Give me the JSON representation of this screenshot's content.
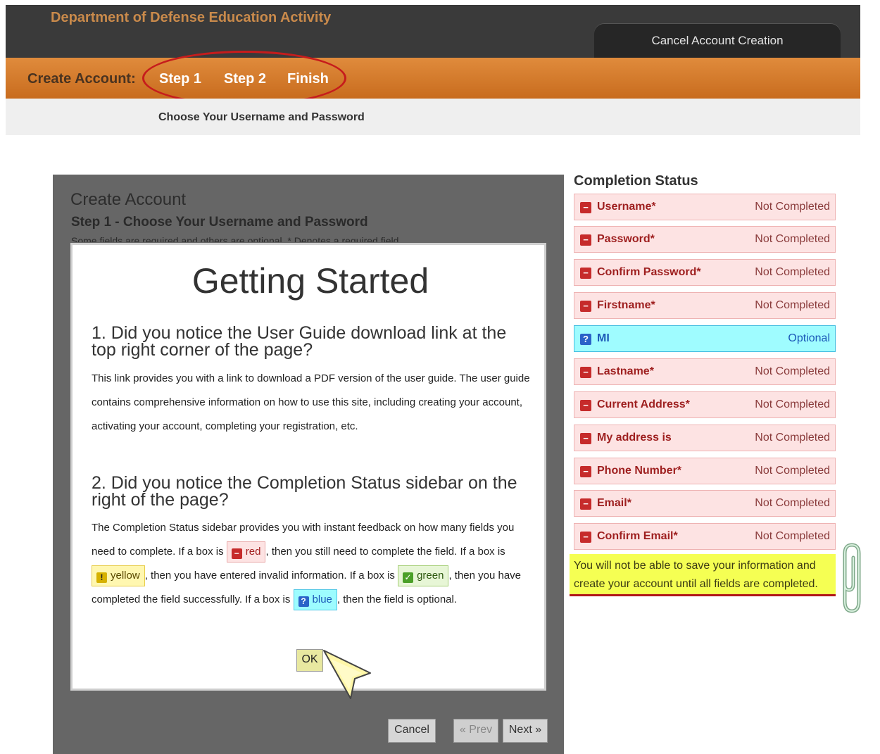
{
  "header": {
    "org_title": "Department of Defense Education Activity",
    "cancel_label": "Cancel Account Creation"
  },
  "steps": {
    "label": "Create Account:",
    "items": [
      "Step 1",
      "Step 2",
      "Finish"
    ],
    "active_index": 0,
    "subtitle": "Choose Your Username and Password"
  },
  "panel": {
    "title": "Create Account",
    "subtitle": "Step 1 - Choose Your Username and Password",
    "note": "Some fields are required and others are optional. * Denotes a required field."
  },
  "modal": {
    "title": "Getting Started",
    "q1": "1. Did you notice the User Guide download link at the top right corner of the page?",
    "p1": "This link provides you with a link to download a PDF version of the user guide. The user guide contains comprehensive information on how to use this site, including creating your account, activating your account, completing your registration, etc.",
    "q2": "2. Did you notice the Completion Status sidebar on the right of the page?",
    "p2_a": "The Completion Status sidebar provides you with instant feedback on how many fields you need to complete. If a box is",
    "chip_red": "red",
    "p2_b": ", then you still need to complete the field. If a box is",
    "chip_yellow": "yellow",
    "p2_c": ", then you have entered invalid information. If a box is",
    "chip_green": "green",
    "p2_d": ", then you have completed the field successfully. If a box is",
    "chip_blue": "blue",
    "p2_e": ", then the field is optional.",
    "ok_label": "OK"
  },
  "nav": {
    "cancel_label": "Cancel",
    "prev_label": "« Prev",
    "next_label": "Next »"
  },
  "completion_status": {
    "title": "Completion Status",
    "rows": [
      {
        "name": "Username*",
        "status": "Not Completed",
        "kind": "required"
      },
      {
        "name": "Password*",
        "status": "Not Completed",
        "kind": "required"
      },
      {
        "name": "Confirm Password*",
        "status": "Not Completed",
        "kind": "required"
      },
      {
        "name": "Firstname*",
        "status": "Not Completed",
        "kind": "required"
      },
      {
        "name": "MI",
        "status": "Optional",
        "kind": "optional"
      },
      {
        "name": "Lastname*",
        "status": "Not Completed",
        "kind": "required"
      },
      {
        "name": "Current Address*",
        "status": "Not Completed",
        "kind": "required"
      },
      {
        "name": "My address is",
        "status": "Not Completed",
        "kind": "required"
      },
      {
        "name": "Phone Number*",
        "status": "Not Completed",
        "kind": "required"
      },
      {
        "name": "Email*",
        "status": "Not Completed",
        "kind": "required"
      },
      {
        "name": "Confirm Email*",
        "status": "Not Completed",
        "kind": "required"
      }
    ],
    "warning": "You will not be able to save your information and create your account until all fields are completed."
  },
  "icons": {
    "required": "minus-icon",
    "optional": "question-icon",
    "invalid": "exclamation-icon",
    "completed": "check-icon"
  },
  "colors": {
    "accent_orange": "#d77a2c",
    "required_bg": "#fde3e3",
    "optional_bg": "#9ffcff",
    "warning_bg": "#f5ff53",
    "highlight_red": "#c61c1c"
  }
}
